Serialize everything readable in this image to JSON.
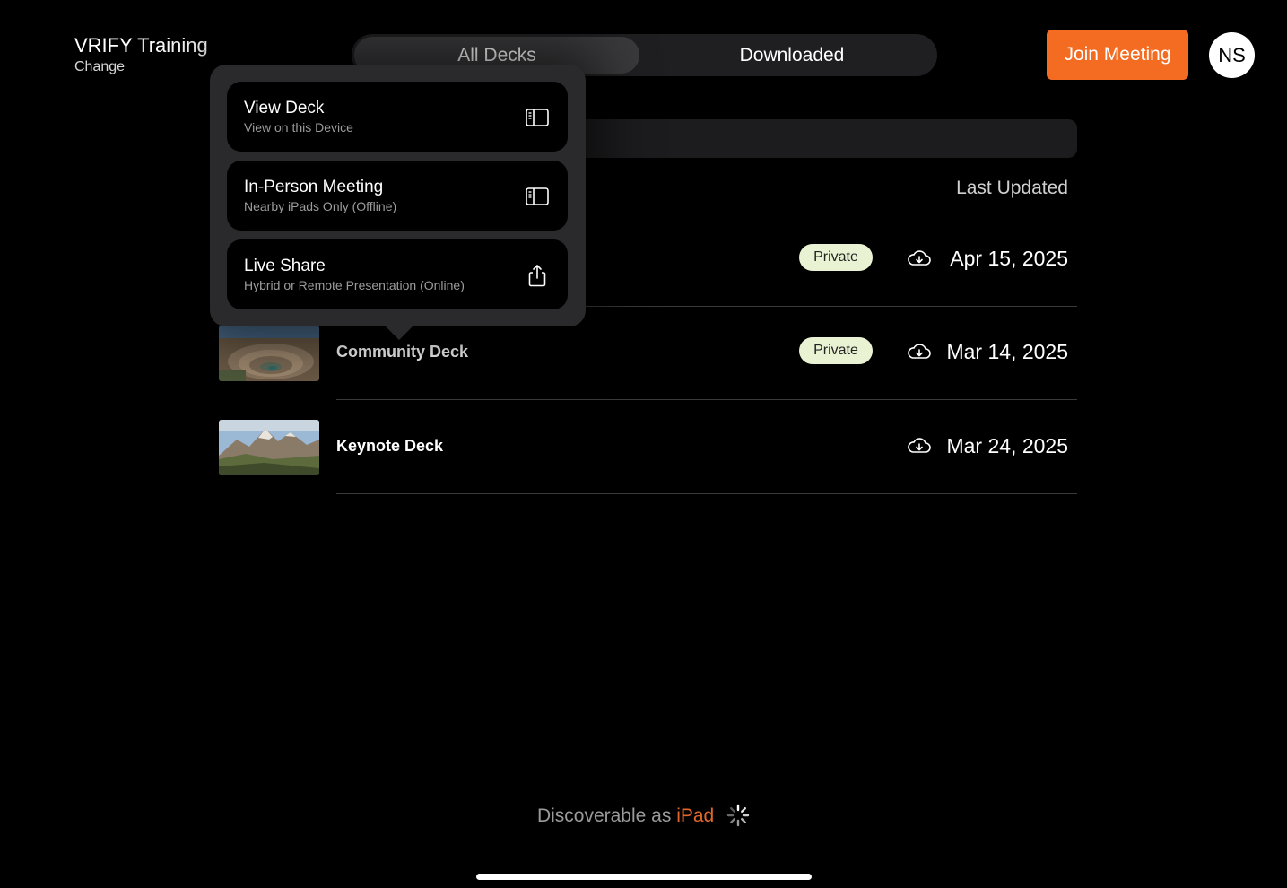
{
  "workspace": {
    "name": "VRIFY Training",
    "change_label": "Change"
  },
  "tabs": [
    {
      "label": "All Decks",
      "active": true
    },
    {
      "label": "Downloaded",
      "active": false
    }
  ],
  "join_button": {
    "label": "Join Meeting",
    "color": "#f36c21"
  },
  "avatar": {
    "initials": "NS"
  },
  "list": {
    "column_header": "Last Updated",
    "rows": [
      {
        "title": "",
        "badge": "Private",
        "date": "Apr 15, 2025",
        "downloadable": true
      },
      {
        "title": "Community Deck",
        "badge": "Private",
        "date": "Mar 14, 2025",
        "downloadable": true
      },
      {
        "title": "Keynote Deck",
        "badge": "",
        "date": "Mar 24, 2025",
        "downloadable": true
      }
    ]
  },
  "popover": {
    "items": [
      {
        "label": "View Deck",
        "sub": "View on this Device",
        "icon": "sidebar-icon"
      },
      {
        "label": "In-Person Meeting",
        "sub": "Nearby iPads Only (Offline)",
        "icon": "sidebar-icon"
      },
      {
        "label": "Live Share",
        "sub": "Hybrid or Remote Presentation (Online)",
        "icon": "share-icon"
      }
    ]
  },
  "footer": {
    "discoverable_prefix": "Discoverable as",
    "device_name": "iPad",
    "accent": "#e0662a"
  }
}
